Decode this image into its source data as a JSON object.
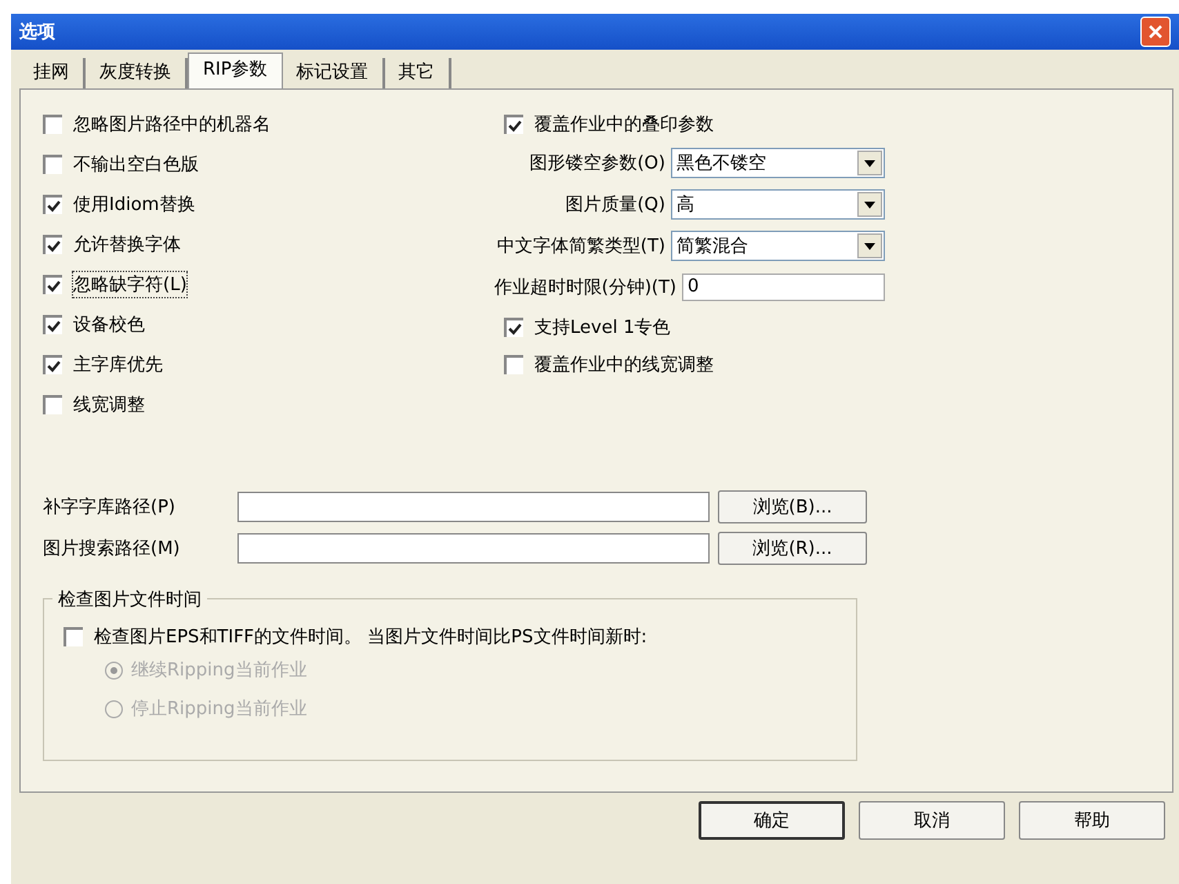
{
  "window": {
    "title": "选项"
  },
  "tabs": [
    {
      "label": "挂网",
      "selected": false
    },
    {
      "label": "灰度转换",
      "selected": false
    },
    {
      "label": "RIP参数",
      "selected": true
    },
    {
      "label": "标记设置",
      "selected": false
    },
    {
      "label": "其它",
      "selected": false
    }
  ],
  "left_options": [
    {
      "label": "忽略图片路径中的机器名",
      "checked": false,
      "focused": false
    },
    {
      "label": "不输出空白色版",
      "checked": false,
      "focused": false
    },
    {
      "label": "使用Idiom替换",
      "checked": true,
      "focused": false
    },
    {
      "label": "允许替换字体",
      "checked": true,
      "focused": false
    },
    {
      "label": "忽略缺字符(L)",
      "checked": true,
      "focused": true
    },
    {
      "label": "设备校色",
      "checked": true,
      "focused": false
    },
    {
      "label": "主字库优先",
      "checked": true,
      "focused": false
    },
    {
      "label": "线宽调整",
      "checked": false,
      "focused": false
    }
  ],
  "right_options": [
    {
      "kind": "checkbox",
      "label": "覆盖作业中的叠印参数",
      "checked": true
    },
    {
      "kind": "combo",
      "label": "图形镂空参数(O)",
      "value": "黑色不镂空"
    },
    {
      "kind": "combo",
      "label": "图片质量(Q)",
      "value": "高"
    },
    {
      "kind": "combo",
      "label": "中文字体简繁类型(T)",
      "value": "简繁混合"
    },
    {
      "kind": "text",
      "label": "作业超时时限(分钟)(T)",
      "value": "0"
    },
    {
      "kind": "checkbox",
      "label": "支持Level 1专色",
      "checked": true
    },
    {
      "kind": "checkbox",
      "label": "覆盖作业中的线宽调整",
      "checked": false
    }
  ],
  "paths": [
    {
      "label": "补字字库路径(P)",
      "button": "浏览(B)..."
    },
    {
      "label": "图片搜索路径(M)",
      "button": "浏览(R)..."
    }
  ],
  "file_time_group": {
    "title": "检查图片文件时间",
    "check": {
      "label": "检查图片EPS和TIFF的文件时间。 当图片文件时间比PS文件时间新时:",
      "checked": false
    },
    "radios": [
      {
        "label": "继续Ripping当前作业",
        "selected": true,
        "disabled": true
      },
      {
        "label": "停止Ripping当前作业",
        "selected": false,
        "disabled": true
      }
    ]
  },
  "buttons": [
    {
      "label": "确定",
      "default": true
    },
    {
      "label": "取消",
      "default": false
    },
    {
      "label": "帮助",
      "default": false
    }
  ]
}
